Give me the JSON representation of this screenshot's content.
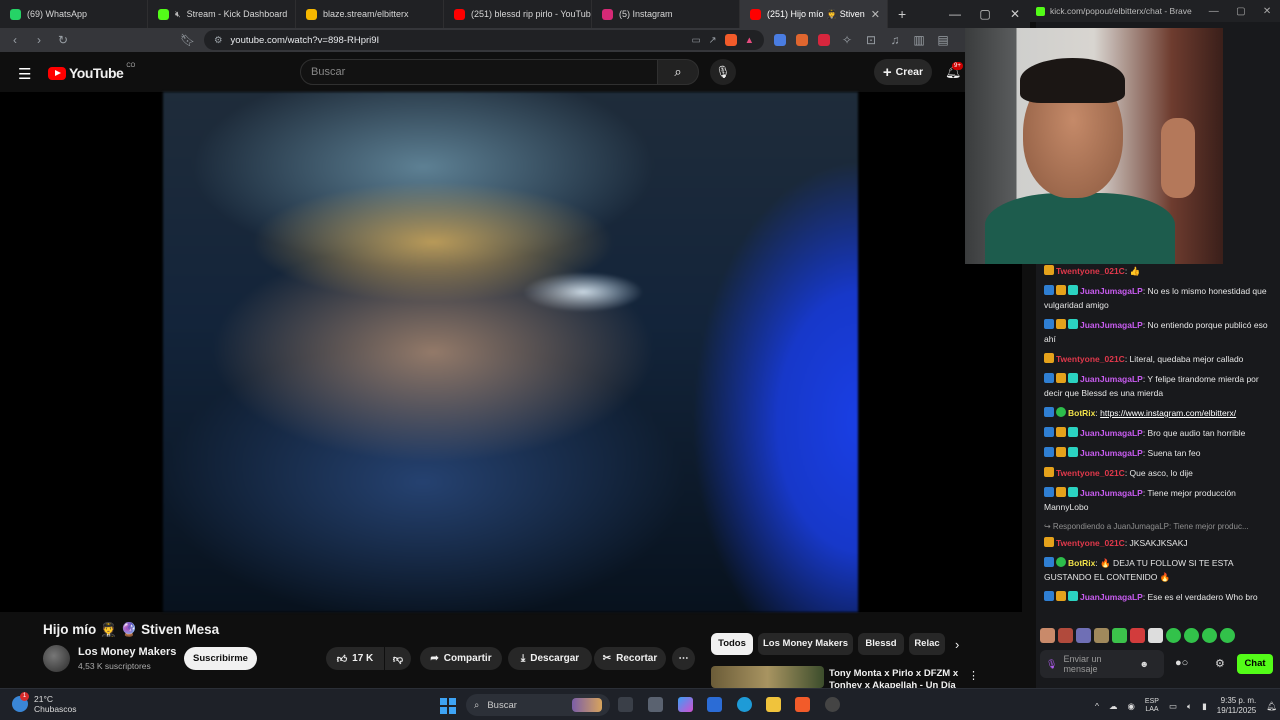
{
  "browser": {
    "tabs": [
      {
        "label": "(69) WhatsApp",
        "color": "#25d366"
      },
      {
        "label": "Stream - Kick Dashboard",
        "color": "#53fc18"
      },
      {
        "label": "blaze.stream/elbitterx",
        "color": "#f5b700"
      },
      {
        "label": "(251) blessd rip pirlo - YouTube",
        "color": "#ff0000"
      },
      {
        "label": "(5) Instagram",
        "color": "#d62976"
      },
      {
        "label": "(251) Hijo mío 🧑‍✈️ Stiven",
        "color": "#ff0000"
      }
    ],
    "new_tab": "+",
    "url": "youtube.com/watch?v=898-RHpri9I"
  },
  "youtube": {
    "logo_text": "YouTube",
    "country_code": "CO",
    "search_placeholder": "Buscar",
    "create_label": "Crear",
    "notif_count": "9+",
    "video_title": "Hijo mío 🧑‍✈️ 🔮 Stiven Mesa",
    "channel_name": "Los Money Makers",
    "subscribers": "4,53 K suscriptores",
    "subscribe_label": "Suscribirme",
    "likes": "17 K",
    "share_label": "Compartir",
    "download_label": "Descargar",
    "clip_label": "Recortar",
    "chips": [
      "Todos",
      "Los Money Makers",
      "Blessd",
      "Relac"
    ],
    "related_title": "Tony Monta x Pirlo x DFZM x Tonhey x Akapellah - Un Día E"
  },
  "kick": {
    "popout_url": "kick.com/popout/elbitterx/chat - Brave",
    "input_placeholder": "Enviar un mensaje",
    "chat_button": "Chat",
    "messages": [
      {
        "user": "Twentyone_021C",
        "color": "#e0384b",
        "badges": [
          "gold"
        ],
        "text": ": 👍"
      },
      {
        "user": "JuanJumagaLP",
        "color": "#c85cf0",
        "badges": [
          "blue",
          "gold",
          "teal"
        ],
        "text": ": No es lo mismo honestidad que vulgaridad amigo"
      },
      {
        "user": "JuanJumagaLP",
        "color": "#c85cf0",
        "badges": [
          "blue",
          "gold",
          "teal"
        ],
        "text": ": No entiendo porque publicó eso ahí"
      },
      {
        "user": "Twentyone_021C",
        "color": "#e0384b",
        "badges": [
          "gold"
        ],
        "text": ": Literal, quedaba mejor callado"
      },
      {
        "user": "JuanJumagaLP",
        "color": "#c85cf0",
        "badges": [
          "blue",
          "gold",
          "teal"
        ],
        "text": ": Y felipe tirandome mierda por decir que Blessd es una mierda"
      },
      {
        "user": "BotRix",
        "color": "#f0e14a",
        "badges": [
          "blue",
          "green"
        ],
        "text": ": ",
        "link": "https://www.instagram.com/elbitterx/"
      },
      {
        "user": "JuanJumagaLP",
        "color": "#c85cf0",
        "badges": [
          "blue",
          "gold",
          "teal"
        ],
        "text": ": Bro que audio tan horrible"
      },
      {
        "user": "JuanJumagaLP",
        "color": "#c85cf0",
        "badges": [
          "blue",
          "gold",
          "teal"
        ],
        "text": ": Suena tan feo"
      },
      {
        "user": "Twentyone_021C",
        "color": "#e0384b",
        "badges": [
          "gold"
        ],
        "text": ": Que asco, lo dije"
      },
      {
        "user": "JuanJumagaLP",
        "color": "#c85cf0",
        "badges": [
          "blue",
          "gold",
          "teal"
        ],
        "text": ": Tiene mejor producción MannyLobo"
      },
      {
        "reply": "↪ Respondiendo a JuanJumagaLP: Tiene mejor produc...",
        "user": "Twentyone_021C",
        "color": "#e0384b",
        "badges": [
          "gold"
        ],
        "text": ": JKSAKJKSAKJ"
      },
      {
        "user": "BotRix",
        "color": "#f0e14a",
        "badges": [
          "blue",
          "green"
        ],
        "text": ": 🔥 DEJA TU FOLLOW SI TE ESTA GUSTANDO EL CONTENIDO 🔥"
      },
      {
        "user": "JuanJumagaLP",
        "color": "#c85cf0",
        "badges": [
          "blue",
          "gold",
          "teal"
        ],
        "text": ": Ese es el verdadero Who bro"
      }
    ]
  },
  "taskbar": {
    "temperature": "21°C",
    "weather": "Chubascos",
    "weather_badge": "1",
    "search_label": "Buscar",
    "lang_top": "ESP",
    "lang_bottom": "LAA",
    "time": "9:35 p. m.",
    "date": "19/11/2025"
  }
}
